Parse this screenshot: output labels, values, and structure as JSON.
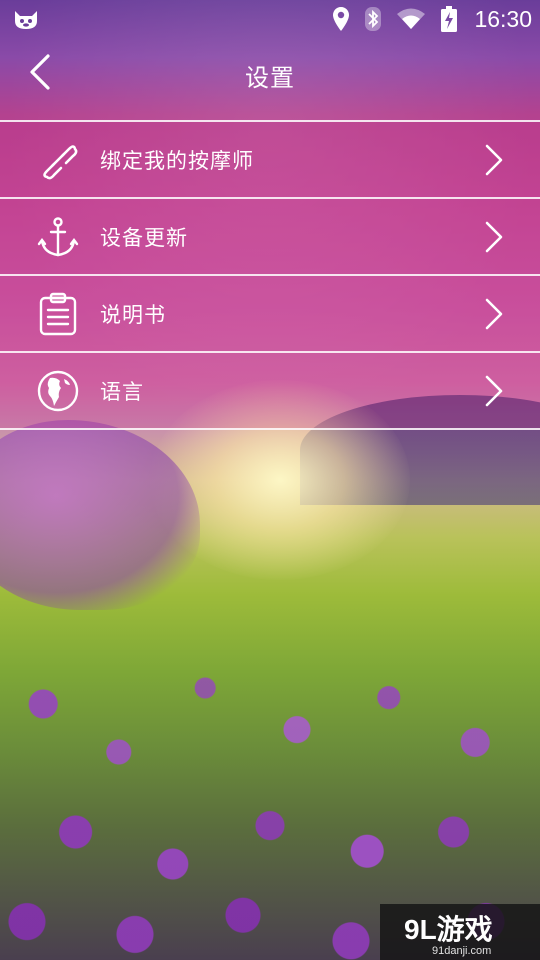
{
  "status_bar": {
    "time": "16:30",
    "icons": [
      "app-notification-icon",
      "location-icon",
      "bluetooth-icon",
      "wifi-icon",
      "battery-charging-icon"
    ]
  },
  "header": {
    "title": "设置",
    "back_icon": "back-arrow-icon"
  },
  "settings": {
    "items": [
      {
        "label": "绑定我的按摩师",
        "icon": "link-icon"
      },
      {
        "label": "设备更新",
        "icon": "anchor-icon"
      },
      {
        "label": "说明书",
        "icon": "clipboard-icon"
      },
      {
        "label": "语言",
        "icon": "globe-icon"
      }
    ],
    "chevron_icon": "chevron-right-icon"
  },
  "watermark": {
    "logo": "9L游戏",
    "site": "91danji.com"
  },
  "colors": {
    "text": "#ffffff",
    "divider": "#ffffff",
    "header_tint": "#8a4aa8",
    "list_tint": "#c24c98"
  }
}
